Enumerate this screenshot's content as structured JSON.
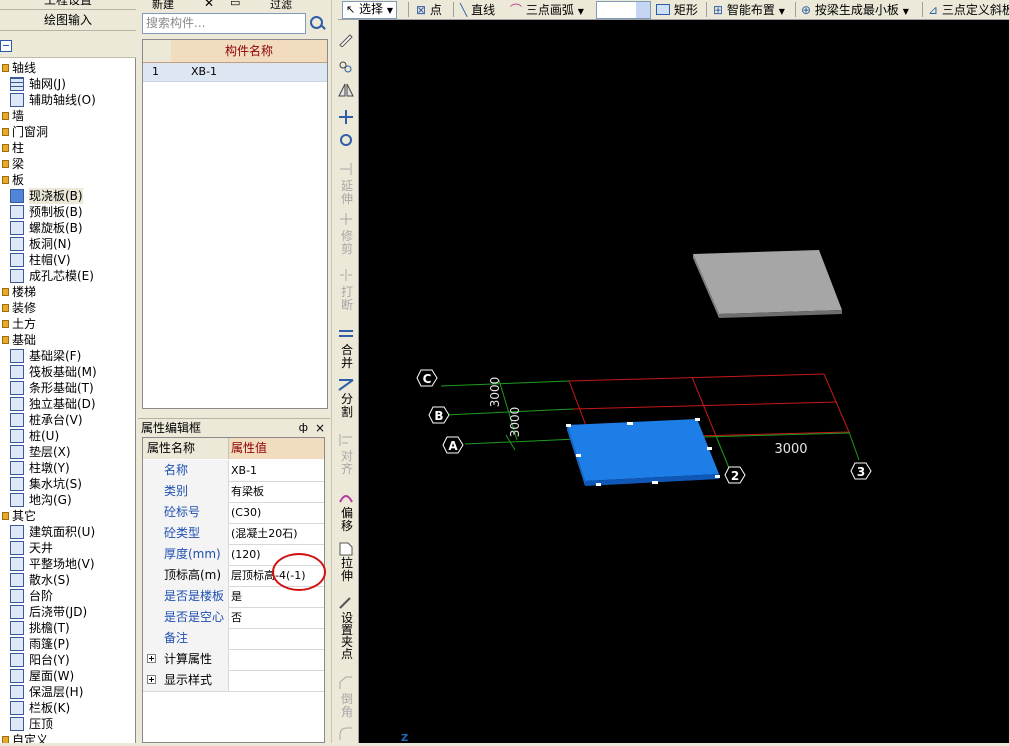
{
  "left_panel": {
    "top_buttons": [
      "工程设置",
      "绘图输入"
    ],
    "tree": [
      {
        "type": "cat",
        "label": "轴线"
      },
      {
        "type": "item",
        "label": "轴网(J)"
      },
      {
        "type": "item",
        "label": "辅助轴线(O)"
      },
      {
        "type": "cat",
        "label": "墙"
      },
      {
        "type": "cat",
        "label": "门窗洞"
      },
      {
        "type": "cat",
        "label": "柱"
      },
      {
        "type": "cat",
        "label": "梁"
      },
      {
        "type": "cat",
        "label": "板"
      },
      {
        "type": "item",
        "label": "现浇板(B)",
        "selected": true
      },
      {
        "type": "item",
        "label": "预制板(B)"
      },
      {
        "type": "item",
        "label": "螺旋板(B)"
      },
      {
        "type": "item",
        "label": "板洞(N)"
      },
      {
        "type": "item",
        "label": "柱帽(V)"
      },
      {
        "type": "item",
        "label": "成孔芯模(E)"
      },
      {
        "type": "cat",
        "label": "楼梯"
      },
      {
        "type": "cat",
        "label": "装修"
      },
      {
        "type": "cat",
        "label": "土方"
      },
      {
        "type": "cat",
        "label": "基础"
      },
      {
        "type": "item",
        "label": "基础梁(F)"
      },
      {
        "type": "item",
        "label": "筏板基础(M)"
      },
      {
        "type": "item",
        "label": "条形基础(T)"
      },
      {
        "type": "item",
        "label": "独立基础(D)"
      },
      {
        "type": "item",
        "label": "桩承台(V)"
      },
      {
        "type": "item",
        "label": "桩(U)"
      },
      {
        "type": "item",
        "label": "垫层(X)"
      },
      {
        "type": "item",
        "label": "柱墩(Y)"
      },
      {
        "type": "item",
        "label": "集水坑(S)"
      },
      {
        "type": "item",
        "label": "地沟(G)"
      },
      {
        "type": "cat",
        "label": "其它"
      },
      {
        "type": "item",
        "label": "建筑面积(U)"
      },
      {
        "type": "item",
        "label": "天井"
      },
      {
        "type": "item",
        "label": "平整场地(V)"
      },
      {
        "type": "item",
        "label": "散水(S)"
      },
      {
        "type": "item",
        "label": "台阶"
      },
      {
        "type": "item",
        "label": "后浇带(JD)"
      },
      {
        "type": "item",
        "label": "挑檐(T)"
      },
      {
        "type": "item",
        "label": "雨篷(P)"
      },
      {
        "type": "item",
        "label": "阳台(Y)"
      },
      {
        "type": "item",
        "label": "屋面(W)"
      },
      {
        "type": "item",
        "label": "保温层(H)"
      },
      {
        "type": "item",
        "label": "栏板(K)"
      },
      {
        "type": "item",
        "label": "压顶"
      },
      {
        "type": "cat",
        "label": "自定义"
      }
    ]
  },
  "component_panel": {
    "toolbar": {
      "new_label": "新建",
      "filter_label": "过滤"
    },
    "search_placeholder": "搜索构件...",
    "column_header": "构件名称",
    "rows": [
      {
        "no": "1",
        "name": "XB-1"
      }
    ]
  },
  "property_panel": {
    "title": "属性编辑框",
    "pin": "ф",
    "close": "×",
    "header_name": "属性名称",
    "header_value": "属性值",
    "rows": [
      {
        "name": "名称",
        "value": "XB-1",
        "link": true
      },
      {
        "name": "类别",
        "value": "有梁板",
        "link": true
      },
      {
        "name": "砼标号",
        "value": "(C30)",
        "link": true
      },
      {
        "name": "砼类型",
        "value": "(混凝土20石)",
        "link": true
      },
      {
        "name": "厚度(mm)",
        "value": "(120)",
        "link": true
      },
      {
        "name": "顶标高(m)",
        "value": "层顶标高-4(-1)",
        "link": false
      },
      {
        "name": "是否是楼板",
        "value": "是",
        "link": true
      },
      {
        "name": "是否是空心",
        "value": "否",
        "link": true
      },
      {
        "name": "备注",
        "value": "",
        "link": true
      },
      {
        "name": "计算属性",
        "value": "",
        "expand": true
      },
      {
        "name": "显示样式",
        "value": "",
        "expand": true
      }
    ]
  },
  "toolbar": {
    "select": "选择",
    "point": "点",
    "line": "直线",
    "arc": "三点画弧",
    "rect": "矩形",
    "smart": "智能布置",
    "beam_slab": "按梁生成最小板",
    "three_pt": "三点定义斜板"
  },
  "vertical_tools": {
    "extend": "延伸",
    "trim": "修剪",
    "break": "打断",
    "merge": "合并",
    "split": "分割",
    "align": "对齐",
    "offset": "偏移",
    "stretch": "拉伸",
    "grip": "设置夹点",
    "chamfer": "倒角"
  },
  "canvas": {
    "axis_labels": [
      "C",
      "B",
      "A",
      "2",
      "3"
    ],
    "dimensions": [
      "3000",
      "3000",
      "3000"
    ],
    "z_axis_label": "Z",
    "colors": {
      "background": "#000000",
      "grid_green": "#1f9a1f",
      "grid_red": "#c81818",
      "slab_blue": "#1e7ee8",
      "slab_gray": "#a6a6a6"
    }
  }
}
